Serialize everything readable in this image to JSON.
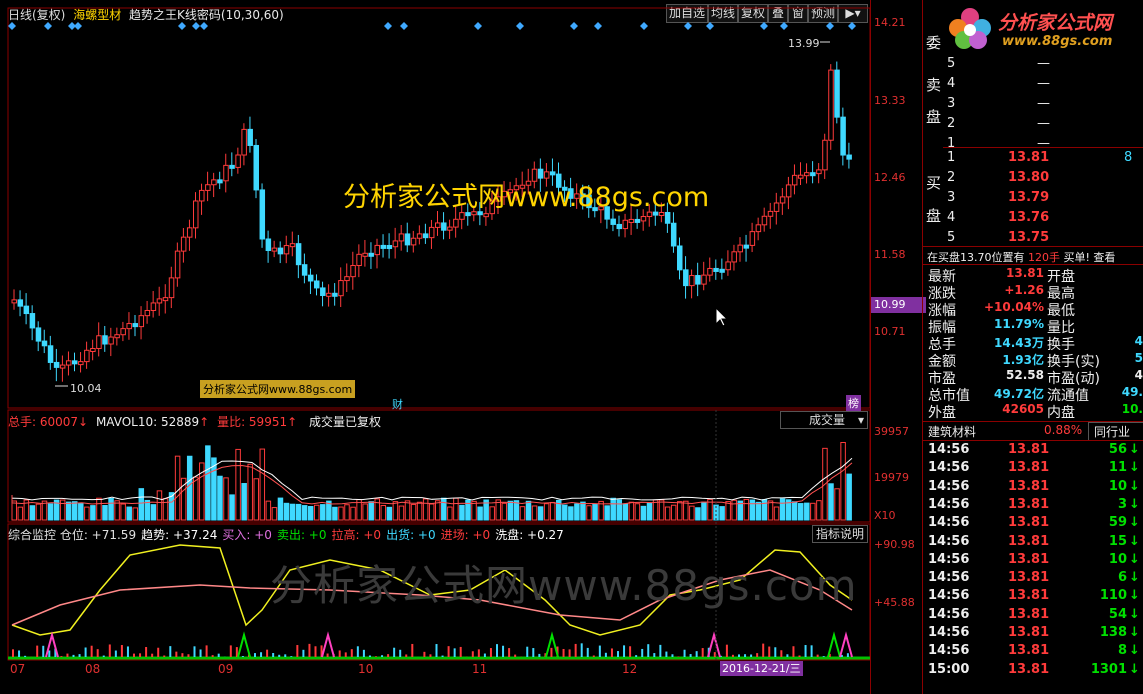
{
  "header": {
    "title_prefix": "日线(复权)",
    "stock_name": "海螺型材",
    "indicator": "趋势之王K线密码(10,30,60)",
    "buttons": [
      "加自选",
      "均线",
      "复权",
      "叠",
      "窗",
      "预测"
    ]
  },
  "price_axis": [
    "14.21",
    "13.33",
    "12.46",
    "11.58",
    "10.99",
    "10.71"
  ],
  "price_annotations": {
    "high": "13.99",
    "low": "10.04"
  },
  "watermark_main": "分析家公式网www.88gs.com",
  "watermark_small": "分析家公式网www.88gs.com",
  "watermark_large": "分析家公式网www.88gs.com",
  "marker_cai": "财",
  "marker_bang": "榜",
  "volume_panel": {
    "total": "总手: 60007",
    "mavol": "MAVOL10: 52889",
    "ratio": "量比: 59951",
    "note": "成交量已复权",
    "dropdown": "成交量",
    "axis": [
      "39957",
      "19979",
      "X10"
    ]
  },
  "indicator_panel": {
    "items": [
      {
        "label": "综合监控 仓位: +71.59",
        "color": "#e0e0e0"
      },
      {
        "label": "趋势: +37.24",
        "color": "#ffffff"
      },
      {
        "label": "买入: +0",
        "color": "#e070e0"
      },
      {
        "label": "卖出: +0",
        "color": "#00e000"
      },
      {
        "label": "拉高: +0",
        "color": "#ff3b3b"
      },
      {
        "label": "出货: +0",
        "color": "#3fd9ff"
      },
      {
        "label": "进场: +0",
        "color": "#ff3b3b"
      },
      {
        "label": "洗盘: +0.27",
        "color": "#ffffff"
      }
    ],
    "help_button": "指标说明",
    "axis": [
      "+90.98",
      "+45.88"
    ]
  },
  "x_axis": [
    "07",
    "08",
    "09",
    "10",
    "11",
    "12"
  ],
  "date_cursor": "2016-12-21/三",
  "logo": {
    "text": "分析家公式网",
    "url": "www.88gs.com"
  },
  "order_book": {
    "sell_label_1": "委",
    "sell_label_2": "卖",
    "sell_label_3": "盘",
    "buy_label_1": "买",
    "buy_label_2": "盘",
    "sells": [
      {
        "n": "5",
        "p": "—"
      },
      {
        "n": "4",
        "p": "—"
      },
      {
        "n": "3",
        "p": "—"
      },
      {
        "n": "2",
        "p": "—"
      },
      {
        "n": "1",
        "p": "—"
      }
    ],
    "buys": [
      {
        "n": "1",
        "p": "13.81",
        "v": "8"
      },
      {
        "n": "2",
        "p": "13.80",
        "v": ""
      },
      {
        "n": "3",
        "p": "13.79",
        "v": ""
      },
      {
        "n": "4",
        "p": "13.76",
        "v": ""
      },
      {
        "n": "5",
        "p": "13.75",
        "v": ""
      }
    ],
    "note": "在买盘13.70位置有",
    "note_red": "120手",
    "note_end": "买单! 查看"
  },
  "quote": [
    {
      "k1": "最新",
      "v1": "13.81",
      "c1": "red",
      "k2": "开盘",
      "v2": "",
      "c2": "red"
    },
    {
      "k1": "涨跌",
      "v1": "+1.26",
      "c1": "red",
      "k2": "最高",
      "v2": "",
      "c2": "red"
    },
    {
      "k1": "涨幅",
      "v1": "+10.04%",
      "c1": "red",
      "k2": "最低",
      "v2": "",
      "c2": "red"
    },
    {
      "k1": "振幅",
      "v1": "11.79%",
      "c1": "cyan",
      "k2": "量比",
      "v2": "",
      "c2": "cyan"
    },
    {
      "k1": "总手",
      "v1": "14.43万",
      "c1": "cyan",
      "k2": "换手",
      "v2": "4",
      "c2": "cyan"
    },
    {
      "k1": "金额",
      "v1": "1.93亿",
      "c1": "cyan",
      "k2": "换手(实)",
      "v2": "5",
      "c2": "cyan"
    },
    {
      "k1": "市盈",
      "v1": "52.58",
      "c1": "white",
      "k2": "市盈(动)",
      "v2": "4",
      "c2": "white"
    },
    {
      "k1": "总市值",
      "v1": "49.72亿",
      "c1": "cyan",
      "k2": "流通值",
      "v2": "49.",
      "c2": "cyan"
    },
    {
      "k1": "外盘",
      "v1": "42605",
      "c1": "red",
      "k2": "内盘",
      "v2": "10.",
      "c2": "green"
    }
  ],
  "industry": {
    "name": "建筑材料",
    "pct": "0.88%",
    "tab": "同行业"
  },
  "ticks": [
    {
      "t": "14:56",
      "p": "13.81",
      "v": "56"
    },
    {
      "t": "14:56",
      "p": "13.81",
      "v": "11"
    },
    {
      "t": "14:56",
      "p": "13.81",
      "v": "10"
    },
    {
      "t": "14:56",
      "p": "13.81",
      "v": "3"
    },
    {
      "t": "14:56",
      "p": "13.81",
      "v": "59"
    },
    {
      "t": "14:56",
      "p": "13.81",
      "v": "15"
    },
    {
      "t": "14:56",
      "p": "13.81",
      "v": "10"
    },
    {
      "t": "14:56",
      "p": "13.81",
      "v": "6"
    },
    {
      "t": "14:56",
      "p": "13.81",
      "v": "110"
    },
    {
      "t": "14:56",
      "p": "13.81",
      "v": "54"
    },
    {
      "t": "14:56",
      "p": "13.81",
      "v": "138"
    },
    {
      "t": "14:56",
      "p": "13.81",
      "v": "8"
    },
    {
      "t": "15:00",
      "p": "13.81",
      "v": "1301"
    }
  ],
  "colors": {
    "up": "#ff3b3b",
    "down": "#3fd9ff",
    "ma1": "#ffffff",
    "ma2": "#ff5050",
    "trend": "#f0f020",
    "trend2": "#ff8888",
    "grid": "#8b0000"
  }
}
